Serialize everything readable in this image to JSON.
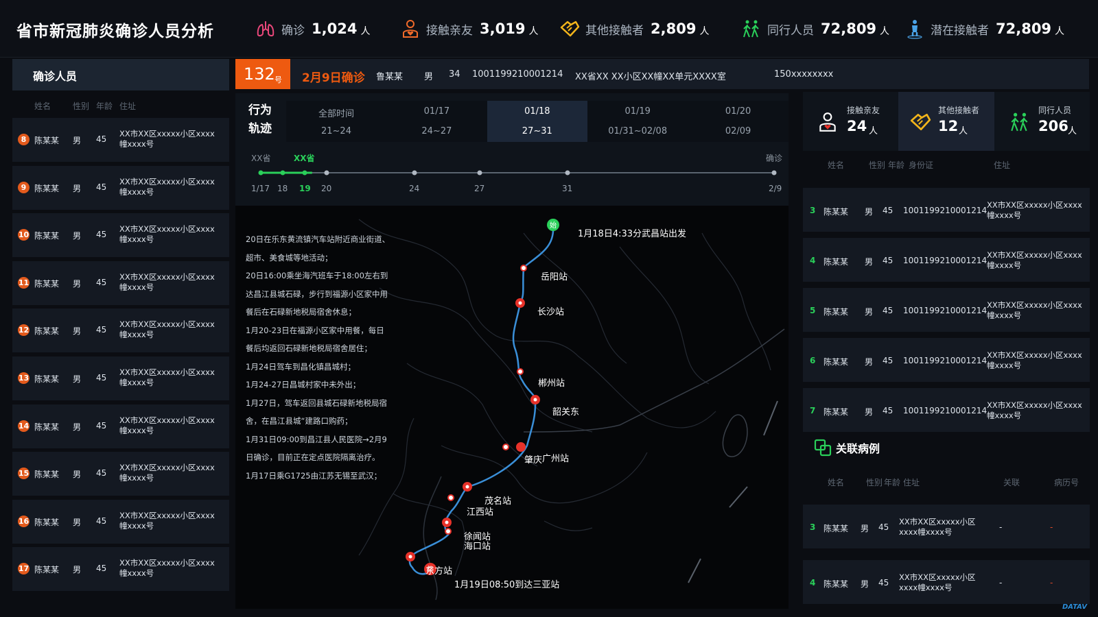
{
  "app_title": "省市新冠肺炎确诊人员分析",
  "stats": [
    {
      "label": "确诊",
      "value": "1,024",
      "unit": "人",
      "icon": "lungs-icon",
      "color": "#e8477a"
    },
    {
      "label": "接触亲友",
      "value": "3,019",
      "unit": "人",
      "icon": "person-heart-icon",
      "color": "#f06a2a"
    },
    {
      "label": "其他接触者",
      "value": "2,809",
      "unit": "人",
      "icon": "handshake-icon",
      "color": "#f3b51b"
    },
    {
      "label": "同行人员",
      "value": "72,809",
      "unit": "人",
      "icon": "walking-people-icon",
      "color": "#2ad05a"
    },
    {
      "label": "潜在接触者",
      "value": "72,809",
      "unit": "人",
      "icon": "standing-person-icon",
      "color": "#4aa3e8"
    }
  ],
  "left_panel": {
    "title": "确诊人员",
    "columns": [
      "姓名",
      "性别",
      "年龄",
      "住址"
    ],
    "rows": [
      {
        "num": "8",
        "name": "陈某某",
        "sex": "男",
        "age": "45",
        "addr": "XX市XX区xxxxx小区xxxx幢xxxx号"
      },
      {
        "num": "9",
        "name": "陈某某",
        "sex": "男",
        "age": "45",
        "addr": "XX市XX区xxxxx小区xxxx幢xxxx号"
      },
      {
        "num": "10",
        "name": "陈某某",
        "sex": "男",
        "age": "45",
        "addr": "XX市XX区xxxxx小区xxxx幢xxxx号"
      },
      {
        "num": "11",
        "name": "陈某某",
        "sex": "男",
        "age": "45",
        "addr": "XX市XX区xxxxx小区xxxx幢xxxx号"
      },
      {
        "num": "12",
        "name": "陈某某",
        "sex": "男",
        "age": "45",
        "addr": "XX市XX区xxxxx小区xxxx幢xxxx号"
      },
      {
        "num": "13",
        "name": "陈某某",
        "sex": "男",
        "age": "45",
        "addr": "XX市XX区xxxxx小区xxxx幢xxxx号"
      },
      {
        "num": "14",
        "name": "陈某某",
        "sex": "男",
        "age": "45",
        "addr": "XX市XX区xxxxx小区xxxx幢xxxx号"
      },
      {
        "num": "15",
        "name": "陈某某",
        "sex": "男",
        "age": "45",
        "addr": "XX市XX区xxxxx小区xxxx幢xxxx号"
      },
      {
        "num": "16",
        "name": "陈某某",
        "sex": "男",
        "age": "45",
        "addr": "XX市XX区xxxxx小区xxxx幢xxxx号"
      },
      {
        "num": "17",
        "name": "陈某某",
        "sex": "男",
        "age": "45",
        "addr": "XX市XX区xxxxx小区xxxx幢xxxx号"
      }
    ]
  },
  "case": {
    "number": "132",
    "number_unit": "号",
    "date": "2月9日确诊",
    "name": "鲁某某",
    "sex": "男",
    "age": "34",
    "id": "1001199210001214",
    "address": "XX省XX XX小区XX幢XX单元XXXX室",
    "phone": "150xxxxxxxx"
  },
  "track": {
    "label": "行为轨迹",
    "tabs": [
      {
        "top": "全部时间",
        "bottom": "21~24"
      },
      {
        "top": "01/17",
        "bottom": "24~27"
      },
      {
        "top": "01/18",
        "bottom": "27~31"
      },
      {
        "top": "01/19",
        "bottom": "01/31~02/08"
      },
      {
        "top": "01/20",
        "bottom": "02/09"
      }
    ],
    "active_tab": 2,
    "timeline_labels": {
      "prov1": "XX省",
      "prov2": "XX省",
      "end": "确诊"
    },
    "ticks": [
      "1/17",
      "18",
      "19",
      "20",
      "24",
      "27",
      "31",
      "2/9"
    ],
    "highlight_tick": "19",
    "progress": 0.1
  },
  "story": [
    "20日在乐东黄流镇汽车站附近商业街道、超市、美食城等地活动；",
    "20日16:00乘坐海汽班车于18:00左右到达昌江县城石碌，步行到福源小区家中用餐后在石碌新地税局宿舍休息；",
    "1月20-23日在福源小区家中用餐，每日餐后均返回石碌新地税局宿舍居住；",
    "1月24日驾车到昌化镇昌城村；",
    "1月24-27日昌城村家中未外出；",
    "1月27日，驾车返回县城石碌新地税局宿舍，在昌江县城“建路口购药；",
    "1月31日09:00到昌江县人民医院→2月9日确诊，目前正在定点医院隔离治疗。",
    "1月17日乘G1725由江苏无锡至武汉；"
  ],
  "map": {
    "start_label": "1月18日4:33分武昌站出发",
    "start_badge": "始",
    "end_label": "1月19日08:50到达三亚站",
    "end_badge": "终",
    "stations": [
      "岳阳站",
      "长沙站",
      "郴州站",
      "韶关东",
      "肇庆",
      "广州站",
      "茂名站",
      "江西站",
      "徐闻站",
      "海口站",
      "东方站"
    ]
  },
  "right_panel": {
    "stats": [
      {
        "label": "接触亲友",
        "value": "24",
        "unit": "人",
        "icon": "person-heart-icon"
      },
      {
        "label": "其他接触者",
        "value": "12",
        "unit": "人",
        "icon": "handshake-icon"
      },
      {
        "label": "同行人员",
        "value": "206",
        "unit": "人",
        "icon": "walking-people-icon"
      }
    ],
    "contacts_columns": [
      "姓名",
      "性别",
      "年龄",
      "身份证",
      "住址"
    ],
    "contacts": [
      {
        "num": "3",
        "name": "陈某某",
        "sex": "男",
        "age": "45",
        "id": "1001199210001214",
        "addr": "XX市XX区xxxxx小区xxxx幢xxxx号"
      },
      {
        "num": "4",
        "name": "陈某某",
        "sex": "男",
        "age": "45",
        "id": "1001199210001214",
        "addr": "XX市XX区xxxxx小区xxxx幢xxxx号"
      },
      {
        "num": "5",
        "name": "陈某某",
        "sex": "男",
        "age": "45",
        "id": "1001199210001214",
        "addr": "XX市XX区xxxxx小区xxxx幢xxxx号"
      },
      {
        "num": "6",
        "name": "陈某某",
        "sex": "男",
        "age": "45",
        "id": "1001199210001214",
        "addr": "XX市XX区xxxxx小区xxxx幢xxxx号"
      },
      {
        "num": "7",
        "name": "陈某某",
        "sex": "男",
        "age": "45",
        "id": "1001199210001214",
        "addr": "XX市XX区xxxxx小区xxxx幢xxxx号"
      }
    ],
    "related_title": "关联病例",
    "related_columns": [
      "姓名",
      "性别",
      "年龄",
      "住址",
      "关联",
      "病历号"
    ],
    "related": [
      {
        "num": "3",
        "name": "陈某某",
        "sex": "男",
        "age": "45",
        "addr": "XX市XX区xxxxx小区xxxx幢xxxx号",
        "rel": "-",
        "rec": "-"
      },
      {
        "num": "4",
        "name": "陈某某",
        "sex": "男",
        "age": "45",
        "addr": "XX市XX区xxxxx小区xxxx幢xxxx号",
        "rel": "-",
        "rec": "-"
      }
    ]
  },
  "brand": "DATAV",
  "colors": {
    "accent": "#ee5a10",
    "green": "#2ad05a",
    "route": "#3a8fd8",
    "marker": "#e8322a"
  }
}
